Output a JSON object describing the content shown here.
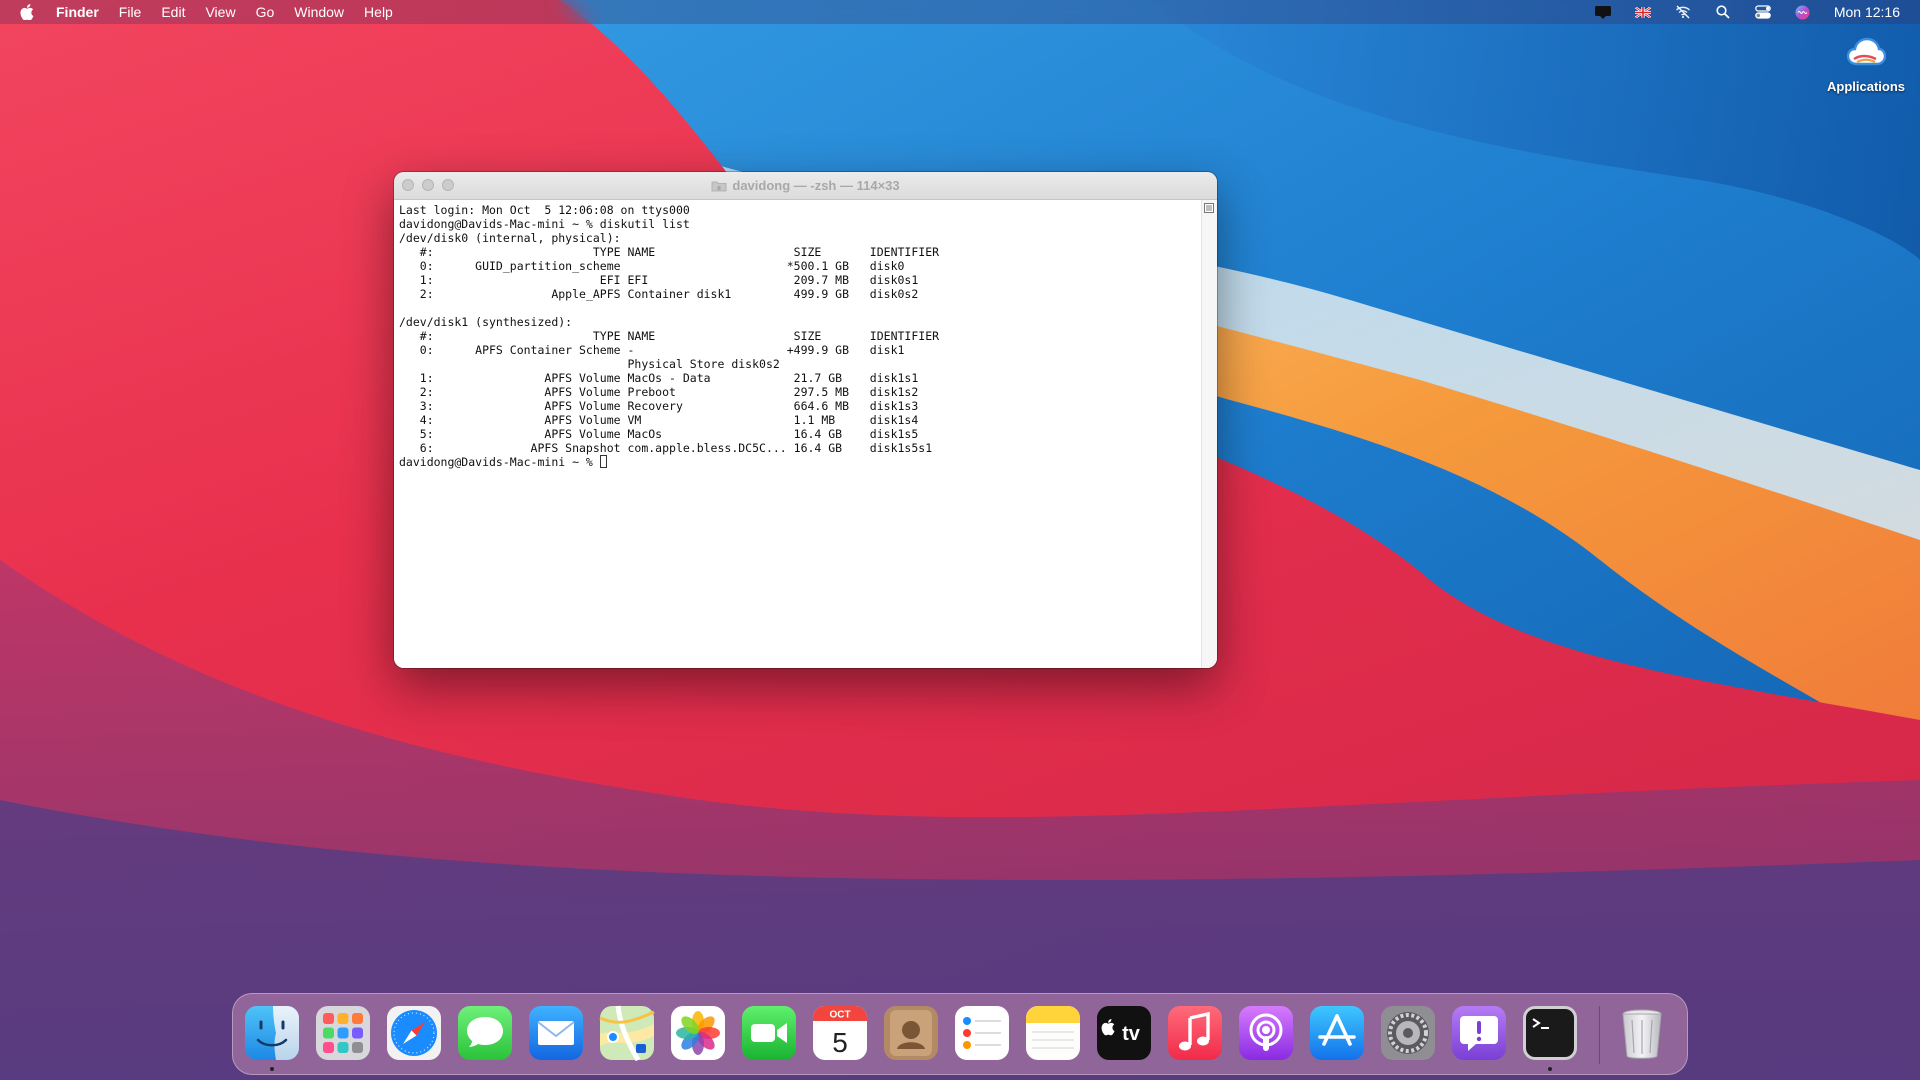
{
  "menubar": {
    "app_name": "Finder",
    "menus": [
      "File",
      "Edit",
      "View",
      "Go",
      "Window",
      "Help"
    ],
    "status_icons": [
      "notification-icon",
      "uk-flag-icon",
      "wifi-off-icon",
      "search-icon",
      "control-center-icon",
      "siri-icon"
    ],
    "clock": "Mon 12:16"
  },
  "desktop": {
    "icon_label": "Applications",
    "icon": "cloud-folder-icon"
  },
  "terminal": {
    "title": "davidong — -zsh — 114×33",
    "lines": [
      "Last login: Mon Oct  5 12:06:08 on ttys000",
      "davidong@Davids-Mac-mini ~ % diskutil list",
      "/dev/disk0 (internal, physical):",
      "   #:                       TYPE NAME                    SIZE       IDENTIFIER",
      "   0:      GUID_partition_scheme                        *500.1 GB   disk0",
      "   1:                        EFI EFI                     209.7 MB   disk0s1",
      "   2:                 Apple_APFS Container disk1         499.9 GB   disk0s2",
      "",
      "/dev/disk1 (synthesized):",
      "   #:                       TYPE NAME                    SIZE       IDENTIFIER",
      "   0:      APFS Container Scheme -                      +499.9 GB   disk1",
      "                                 Physical Store disk0s2",
      "   1:                APFS Volume MacOs - Data            21.7 GB    disk1s1",
      "   2:                APFS Volume Preboot                 297.5 MB   disk1s2",
      "   3:                APFS Volume Recovery                664.6 MB   disk1s3",
      "   4:                APFS Volume VM                      1.1 MB     disk1s4",
      "   5:                APFS Volume MacOs                   16.4 GB    disk1s5",
      "   6:              APFS Snapshot com.apple.bless.DC5C... 16.4 GB    disk1s5s1",
      ""
    ],
    "prompt": "davidong@Davids-Mac-mini ~ % "
  },
  "dock": {
    "calendar_month": "OCT",
    "calendar_day": "5",
    "appletv_label": "tv",
    "items": [
      {
        "name": "finder-icon",
        "running": true
      },
      {
        "name": "launchpad-icon",
        "running": false
      },
      {
        "name": "safari-icon",
        "running": false
      },
      {
        "name": "messages-icon",
        "running": false
      },
      {
        "name": "mail-icon",
        "running": false
      },
      {
        "name": "maps-icon",
        "running": false
      },
      {
        "name": "photos-icon",
        "running": false
      },
      {
        "name": "facetime-icon",
        "running": false
      },
      {
        "name": "calendar-icon",
        "running": false
      },
      {
        "name": "contacts-icon",
        "running": false
      },
      {
        "name": "reminders-icon",
        "running": false
      },
      {
        "name": "notes-icon",
        "running": false
      },
      {
        "name": "appletv-icon",
        "running": false
      },
      {
        "name": "music-icon",
        "running": false
      },
      {
        "name": "podcasts-icon",
        "running": false
      },
      {
        "name": "appstore-icon",
        "running": false
      },
      {
        "name": "system-preferences-icon",
        "running": false
      },
      {
        "name": "feedback-assistant-icon",
        "running": false
      },
      {
        "name": "terminal-icon",
        "running": true
      },
      {
        "name": "trash-icon",
        "running": false
      }
    ]
  }
}
